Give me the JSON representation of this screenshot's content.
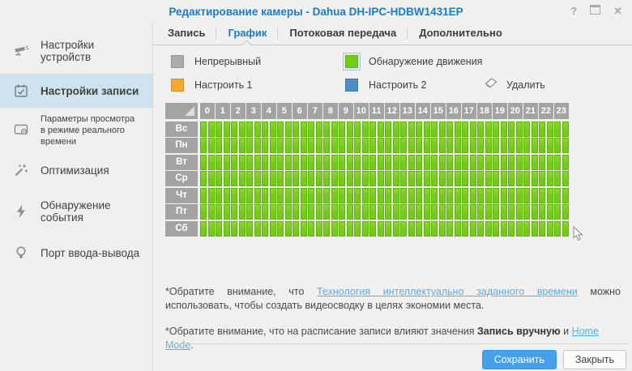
{
  "window": {
    "title": "Редактирование камеры - Dahua DH-IPC-HDBW1431EP",
    "controls": {
      "help": "?",
      "close": "✕"
    }
  },
  "sidebar": {
    "items": [
      {
        "label": "Настройки устройств",
        "active": false
      },
      {
        "label": "Настройки записи",
        "active": true
      },
      {
        "label": "Параметры просмотра в режиме реального времени",
        "active": false
      },
      {
        "label": "Оптимизация",
        "active": false
      },
      {
        "label": "Обнаружение события",
        "active": false
      },
      {
        "label": "Порт ввода-вывода",
        "active": false
      }
    ]
  },
  "tabs": [
    {
      "label": "Запись",
      "active": false
    },
    {
      "label": "График",
      "active": true
    },
    {
      "label": "Потоковая передача",
      "active": false
    },
    {
      "label": "Дополнительно",
      "active": false
    }
  ],
  "legend": {
    "items": [
      {
        "label": "Непрерывный",
        "color": "#ababab",
        "border": "#949494",
        "selected": false
      },
      {
        "label": "Обнаружение движения",
        "color": "#75ca18",
        "border": "#5fb40c",
        "selected": true
      },
      {
        "label": "Настроить 1",
        "color": "#f7a733",
        "border": "#dc9222",
        "selected": false
      },
      {
        "label": "Настроить 2",
        "color": "#4b8fc6",
        "border": "#3a7aae",
        "selected": false
      }
    ],
    "erase_label": "Удалить"
  },
  "schedule": {
    "hours": [
      "0",
      "1",
      "2",
      "3",
      "4",
      "5",
      "6",
      "7",
      "8",
      "9",
      "10",
      "11",
      "12",
      "13",
      "14",
      "15",
      "16",
      "17",
      "18",
      "19",
      "20",
      "21",
      "22",
      "23"
    ],
    "days": [
      "Вс",
      "Пн",
      "Вт",
      "Ср",
      "Чт",
      "Пт",
      "Сб"
    ],
    "cells_per_hour": 2,
    "all_filled": true,
    "filled_with": "Обнаружение движения",
    "fill_color": "#75ca18",
    "fill_border": "#5fb40c",
    "header_bg": "#a3a3a3"
  },
  "notes": [
    {
      "prefix": "*Обратите внимание, что ",
      "link": "Технология интеллектуально заданного времени",
      "suffix": " можно использовать, чтобы создать видеосводку в целях экономии места."
    },
    {
      "prefix": "*Обратите внимание, что на расписание записи влияют значения ",
      "bold": "Запись вручную",
      "middle": " и ",
      "link": "Home Mode",
      "suffix": "."
    }
  ],
  "footer": {
    "save_label": "Сохранить",
    "close_label": "Закрыть",
    "accent_color": "#48a0ea"
  }
}
